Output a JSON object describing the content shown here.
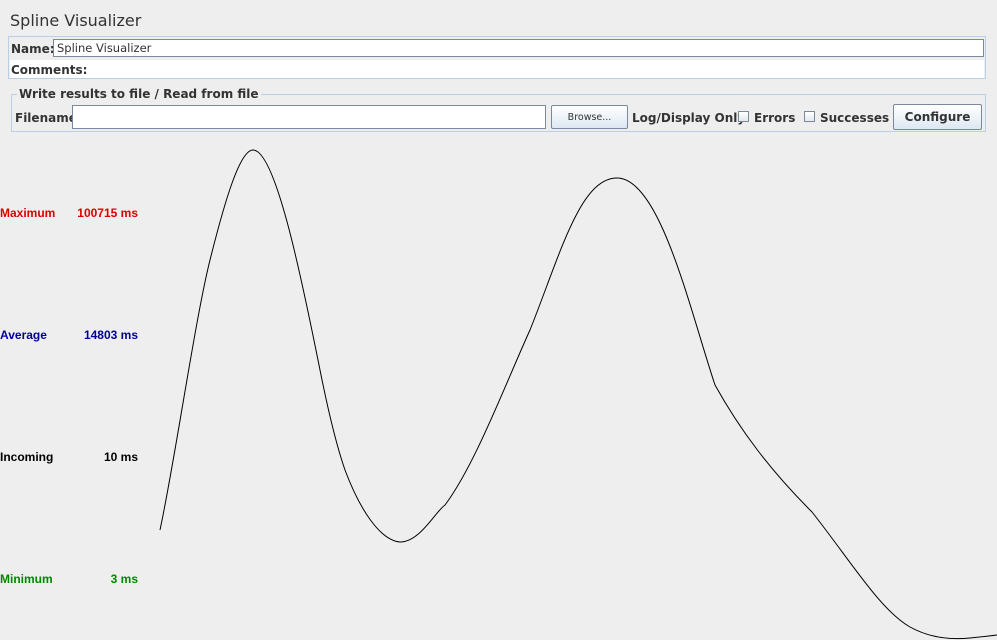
{
  "window": {
    "title": "Spline Visualizer"
  },
  "name_field": {
    "label": "Name:",
    "value": "Spline Visualizer"
  },
  "comments_field": {
    "label": "Comments:"
  },
  "file_panel": {
    "legend": "Write results to file / Read from file",
    "filename_label": "Filename",
    "filename_value": "",
    "browse_label": "Browse...",
    "log_display_label": "Log/Display Only:",
    "errors_label": "Errors",
    "errors_checked": false,
    "successes_label": "Successes",
    "successes_checked": false,
    "configure_label": "Configure"
  },
  "stats": {
    "maximum": {
      "label": "Maximum",
      "value": "100715 ms",
      "color": "#dd0000"
    },
    "average": {
      "label": "Average",
      "value": "14803 ms",
      "color": "#000099"
    },
    "incoming": {
      "label": "Incoming",
      "value": "10 ms",
      "color": "#000000"
    },
    "minimum": {
      "label": "Minimum",
      "value": "3 ms",
      "color": "#008800"
    }
  }
}
